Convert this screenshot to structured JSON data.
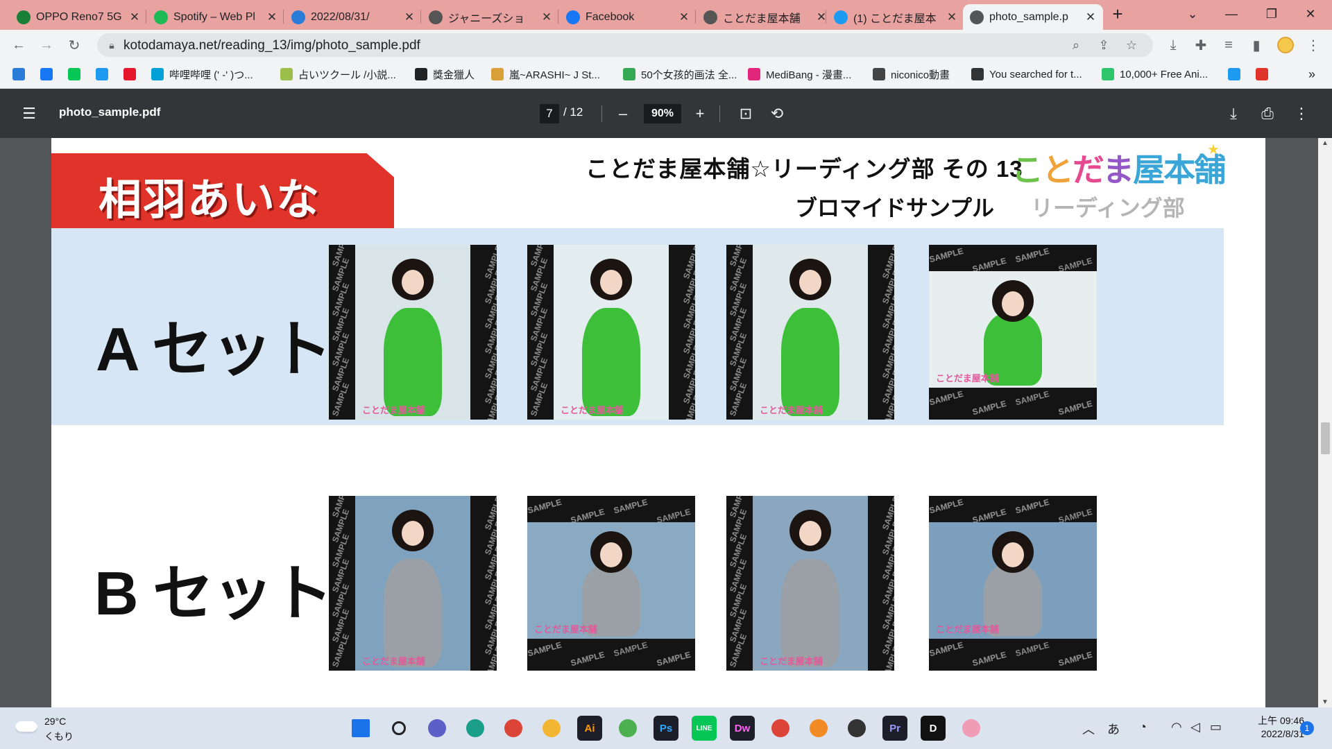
{
  "browser": {
    "tabs": [
      {
        "title": "OPPO Reno7 5G",
        "icon": "oppo-icon",
        "color": "#1a7f37"
      },
      {
        "title": "Spotify – Web Pl",
        "icon": "spotify-icon",
        "color": "#1db954"
      },
      {
        "title": "2022/08/31/",
        "icon": "kotodama-icon",
        "color": "#2b7bd8"
      },
      {
        "title": "ジャニーズショ",
        "icon": "globe-icon",
        "color": "#555555"
      },
      {
        "title": "Facebook",
        "icon": "facebook-icon",
        "color": "#1877f2"
      },
      {
        "title": "ことだま屋本舗",
        "icon": "globe-icon",
        "color": "#555555"
      },
      {
        "title": "(1) ことだま屋本",
        "icon": "twitter-icon",
        "color": "#1d9bf0"
      },
      {
        "title": "photo_sample.p",
        "icon": "globe-icon",
        "color": "#555555",
        "active": true
      }
    ],
    "url": "kotodamaya.net/reading_13/img/photo_sample.pdf",
    "bookmarks": [
      {
        "label": "",
        "icon": "kotodama-icon",
        "color": "#2b7bd8"
      },
      {
        "label": "",
        "icon": "facebook-icon",
        "color": "#1877f2"
      },
      {
        "label": "",
        "icon": "line-icon",
        "color": "#06c755"
      },
      {
        "label": "",
        "icon": "twitter-icon",
        "color": "#1d9bf0"
      },
      {
        "label": "",
        "icon": "weibo-icon",
        "color": "#e6162d"
      },
      {
        "label": "哔哩哔哩 (' -' )つ...",
        "icon": "bilibili-icon",
        "color": "#00a1d6"
      },
      {
        "label": "占いツクール /小説...",
        "icon": "uranai-icon",
        "color": "#9bbf4a"
      },
      {
        "label": "獎金獵人",
        "icon": "bounty-icon",
        "color": "#222222"
      },
      {
        "label": "嵐~ARASHI~ J St...",
        "icon": "js-icon",
        "color": "#d9a03a"
      },
      {
        "label": "50个女孩的画法 全...",
        "icon": "drive-icon",
        "color": "#34a853"
      },
      {
        "label": "MediBang - 漫畫...",
        "icon": "medibang-icon",
        "color": "#e2267c"
      },
      {
        "label": "niconico動畫",
        "icon": "niconico-icon",
        "color": "#444444"
      },
      {
        "label": "You searched for t...",
        "icon": "globe-icon",
        "color": "#333333"
      },
      {
        "label": "10,000+ Free Ani...",
        "icon": "pixabay-icon",
        "color": "#2ec66d"
      },
      {
        "label": "",
        "icon": "twitter-icon",
        "color": "#1d9bf0"
      },
      {
        "label": "",
        "icon": "red-app-icon",
        "color": "#e0332a"
      }
    ],
    "bookmarks_overflow": "»"
  },
  "pdf": {
    "filename": "photo_sample.pdf",
    "page_current": "7",
    "page_total": "/ 12",
    "zoom": "90%",
    "zoom_out": "–",
    "zoom_in": "+",
    "scroll_position": 0.53
  },
  "content": {
    "name": "相羽あいな",
    "header_line1": "ことだま屋本舗☆リーディング部 その 13",
    "header_line2": "ブロマイドサンプル",
    "logo_line1": [
      "こ",
      "と",
      "だ",
      "ま",
      "屋本舗"
    ],
    "logo_line2": "リーディング部",
    "set_a": "A セット",
    "set_b": "B セット",
    "sample_text": "SAMPLE",
    "photo_watermark": "ことだま屋本舗",
    "photos_a": [
      {
        "orientation": "portrait",
        "outfit": "#3dbf3a",
        "bg": "#d9e4e8"
      },
      {
        "orientation": "portrait",
        "outfit": "#3dbf3a",
        "bg": "#e3ecef"
      },
      {
        "orientation": "portrait",
        "outfit": "#3dbf3a",
        "bg": "#dfe9ec"
      },
      {
        "orientation": "landscape",
        "outfit": "#3dbf3a",
        "bg": "#e6eef0"
      }
    ],
    "photos_b": [
      {
        "orientation": "portrait",
        "outfit": "#9aa0a6",
        "bg": "#7fa3bf"
      },
      {
        "orientation": "landscape",
        "outfit": "#9aa0a6",
        "bg": "#8aaac4"
      },
      {
        "orientation": "portrait",
        "outfit": "#9aa0a6",
        "bg": "#8aa7bf"
      },
      {
        "orientation": "landscape",
        "outfit": "#9aa0a6",
        "bg": "#7c9fbd"
      }
    ]
  },
  "taskbar": {
    "weather_temp": "29°C",
    "weather_desc": "くもり",
    "apps": [
      {
        "icon": "windows-start-icon",
        "label": "",
        "color": "#1a73e8"
      },
      {
        "icon": "search-icon",
        "label": "",
        "color": "#222222"
      },
      {
        "icon": "teams-chat-icon",
        "label": "",
        "color": "#5b5fc7"
      },
      {
        "icon": "edge-icon",
        "label": "",
        "color": "#1a9e8a"
      },
      {
        "icon": "chrome-icon",
        "label": "",
        "color": "#db4437"
      },
      {
        "icon": "file-explorer-icon",
        "label": "",
        "color": "#f2b632"
      },
      {
        "icon": "illustrator-icon",
        "label": "Ai",
        "color": "#ff9a00"
      },
      {
        "icon": "globe-app-icon",
        "label": "",
        "color": "#4caf50"
      },
      {
        "icon": "photoshop-icon",
        "label": "Ps",
        "color": "#31a8ff"
      },
      {
        "icon": "line-app-icon",
        "label": "LINE",
        "color": "#06c755"
      },
      {
        "icon": "dreamweaver-icon",
        "label": "Dw",
        "color": "#ff61f6"
      },
      {
        "icon": "chrome-alt-icon",
        "label": "",
        "color": "#db4437"
      },
      {
        "icon": "media-player-icon",
        "label": "",
        "color": "#f28b24"
      },
      {
        "icon": "speech-app-icon",
        "label": "",
        "color": "#333333"
      },
      {
        "icon": "premiere-icon",
        "label": "Pr",
        "color": "#9999ff"
      },
      {
        "icon": "d-app-icon",
        "label": "D",
        "color": "#111111"
      },
      {
        "icon": "anime-app-icon",
        "label": "",
        "color": "#f19bb6"
      }
    ],
    "tray_ime": "あ",
    "time_label": "上午 09:46",
    "date": "2022/8/31",
    "notifications": "1"
  }
}
